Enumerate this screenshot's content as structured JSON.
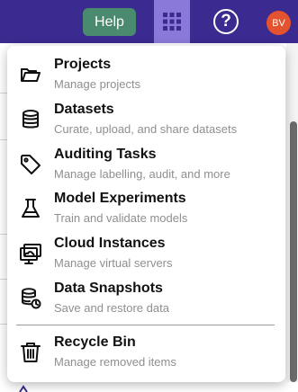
{
  "header": {
    "help_label": "Help",
    "apps_icon": "grid-icon",
    "help_icon": "question-circle-icon",
    "avatar_initials": "BV",
    "colors": {
      "bar": "#3b2a8f",
      "help": "#4a8a6e",
      "apps_active": "#8a79d8",
      "avatar": "#e4532f"
    }
  },
  "menu": {
    "items": [
      {
        "icon": "folder-icon",
        "title": "Projects",
        "subtitle": "Manage projects"
      },
      {
        "icon": "database-icon",
        "title": "Datasets",
        "subtitle": "Curate, upload, and share datasets"
      },
      {
        "icon": "tag-icon",
        "title": "Auditing Tasks",
        "subtitle": "Manage labelling, audit, and more"
      },
      {
        "icon": "flask-icon",
        "title": "Model Experiments",
        "subtitle": "Train and validate models"
      },
      {
        "icon": "cloud-monitor-icon",
        "title": "Cloud Instances",
        "subtitle": "Manage virtual servers"
      },
      {
        "icon": "database-sync-icon",
        "title": "Data Snapshots",
        "subtitle": "Save and restore data"
      },
      {
        "icon": "trash-icon",
        "title": "Recycle Bin",
        "subtitle": "Manage removed items"
      }
    ]
  }
}
